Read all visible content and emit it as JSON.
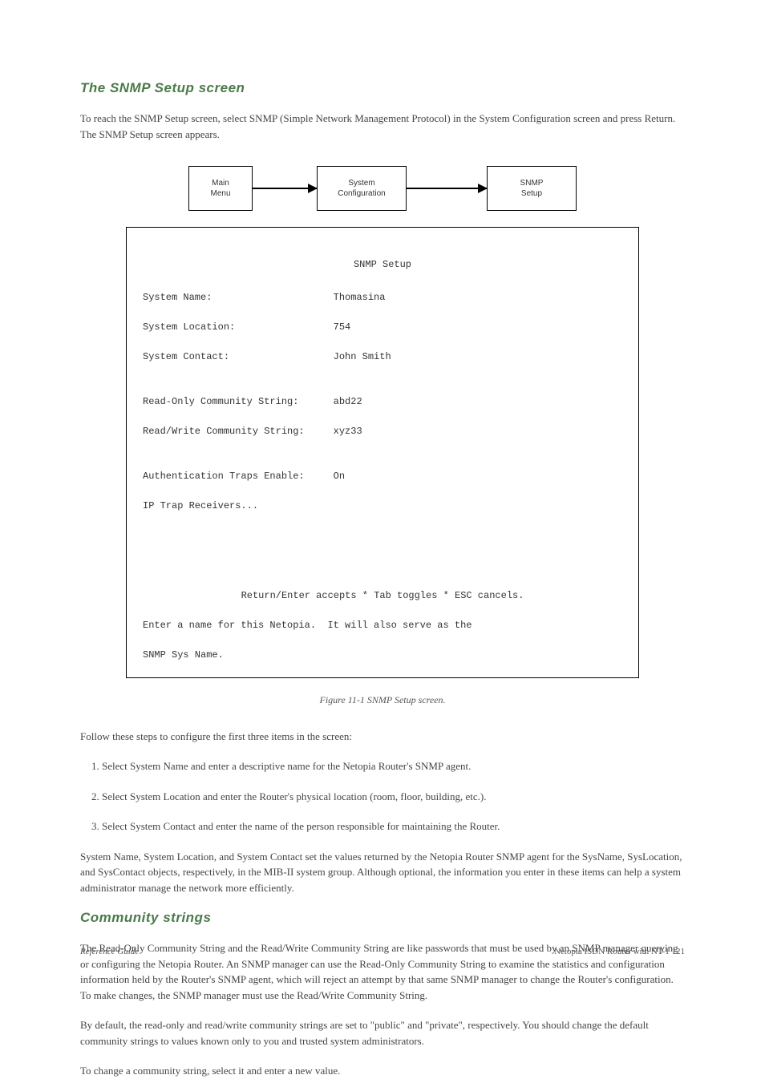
{
  "heading1": "The SNMP Setup screen",
  "intro1": "To reach the SNMP Setup screen, select SNMP (Simple Network Management Protocol) in the System Configuration screen and press Return. The SNMP Setup screen appears.",
  "flow": {
    "box1_line1": "Main",
    "box1_line2": "Menu",
    "box2_line1": "System",
    "box2_line2": "Configuration",
    "box3_line1": "SNMP",
    "box3_line2": "Setup"
  },
  "console": {
    "title": "SNMP Setup",
    "lines": [
      "System Name:                     Thomasina",
      "System Location:                 754",
      "System Contact:                  John Smith",
      "",
      "Read-Only Community String:      abd22",
      "Read/Write Community String:     xyz33",
      "",
      "Authentication Traps Enable:     On",
      "IP Trap Receivers..."
    ],
    "nav": "Return/Enter accepts * Tab toggles * ESC cancels.",
    "hint": "Enter a name for this Netopia.  It will also serve as the",
    "hint2": "SNMP Sys Name."
  },
  "caption": "Figure 11-1  SNMP Setup screen.",
  "para1": "Follow these steps to configure the first three items in the screen:",
  "step1": "1. Select System Name and enter a descriptive name for the Netopia Router's SNMP agent.",
  "step2": "2. Select System Location and enter the Router's physical location (room, floor, building, etc.).",
  "step3": "3. Select System Contact and enter the name of the person responsible for maintaining the Router.",
  "note": "System Name, System Location, and System Contact set the values returned by the Netopia Router SNMP agent for the SysName, SysLocation, and SysContact objects, respectively, in the MIB-II system group. Although optional, the information you enter in these items can help a system administrator manage the network more efficiently.",
  "heading2": "Community strings",
  "cs_para1": "The Read-Only Community String and the Read/Write Community String are like passwords that must be used by an SNMP manager querying or configuring the Netopia Router. An SNMP manager can use the Read-Only Community String to examine the statistics and configuration information held by the Router's SNMP agent, which will reject an attempt by that same SNMP manager to change the Router's configuration. To make changes, the SNMP manager must use the Read/Write Community String.",
  "cs_para2": "By default, the read-only and read/write community strings are set to \"public\" and \"private\", respectively. You should change the default community strings to values known only to you and trusted system administrators.",
  "cs_para3": "To change a community string, select it and enter a new value.",
  "footer_left": "Reference Guide",
  "footer_right": "Netopia ISDN Router with NT-1    121"
}
